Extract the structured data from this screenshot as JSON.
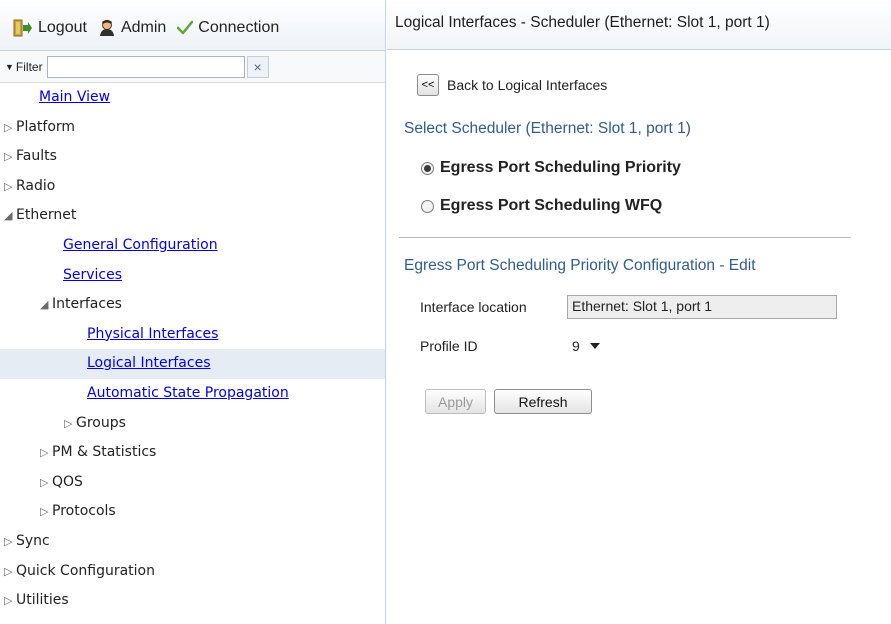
{
  "toolbar": {
    "logout_label": "Logout",
    "admin_label": "Admin",
    "connection_label": "Connection"
  },
  "filter": {
    "label": "Filter",
    "value": "",
    "clear_glyph": "×"
  },
  "tree": [
    {
      "label": "Main View",
      "link": true,
      "level": 0,
      "arrow": ""
    },
    {
      "label": "Platform",
      "link": false,
      "level": 0,
      "arrow": "▷"
    },
    {
      "label": "Faults",
      "link": false,
      "level": 0,
      "arrow": "▷"
    },
    {
      "label": "Radio",
      "link": false,
      "level": 0,
      "arrow": "▷"
    },
    {
      "label": "Ethernet",
      "link": false,
      "level": 0,
      "arrow": "◢"
    },
    {
      "label": "General Configuration",
      "link": true,
      "level": 1,
      "arrow": ""
    },
    {
      "label": "Services",
      "link": true,
      "level": 1,
      "arrow": ""
    },
    {
      "label": "Interfaces",
      "link": false,
      "level": 1,
      "arrow": "◢"
    },
    {
      "label": "Physical Interfaces",
      "link": true,
      "level": 2,
      "arrow": ""
    },
    {
      "label": "Logical Interfaces",
      "link": true,
      "level": 2,
      "arrow": "",
      "selected": true
    },
    {
      "label": "Automatic State Propagation",
      "link": true,
      "level": 2,
      "arrow": ""
    },
    {
      "label": "Groups",
      "link": false,
      "level": 2,
      "arrow": "▷"
    },
    {
      "label": "PM & Statistics",
      "link": false,
      "level": 1,
      "arrow": "▷"
    },
    {
      "label": "QOS",
      "link": false,
      "level": 1,
      "arrow": "▷"
    },
    {
      "label": "Protocols",
      "link": false,
      "level": 1,
      "arrow": "▷"
    },
    {
      "label": "Sync",
      "link": false,
      "level": 0,
      "arrow": "▷"
    },
    {
      "label": "Quick Configuration",
      "link": false,
      "level": 0,
      "arrow": "▷"
    },
    {
      "label": "Utilities",
      "link": false,
      "level": 0,
      "arrow": "▷"
    }
  ],
  "main": {
    "title": "Logical Interfaces - Scheduler (Ethernet: Slot 1, port 1)",
    "back_button": "<<",
    "back_label": "Back to Logical Interfaces",
    "select_heading": "Select Scheduler (Ethernet: Slot 1, port 1)",
    "radio_priority": "Egress Port Scheduling Priority",
    "radio_wfq": "Egress Port Scheduling WFQ",
    "config_heading": "Egress Port Scheduling Priority Configuration - Edit",
    "interface_location_label": "Interface location",
    "interface_location_value": "Ethernet: Slot 1, port 1",
    "profile_id_label": "Profile ID",
    "profile_id_value": "9",
    "apply_label": "Apply",
    "refresh_label": "Refresh"
  },
  "colors": {
    "heading_blue": "#2f5d8f",
    "link_blue": "#0000ee",
    "selected_row": "#e6ecf3"
  }
}
